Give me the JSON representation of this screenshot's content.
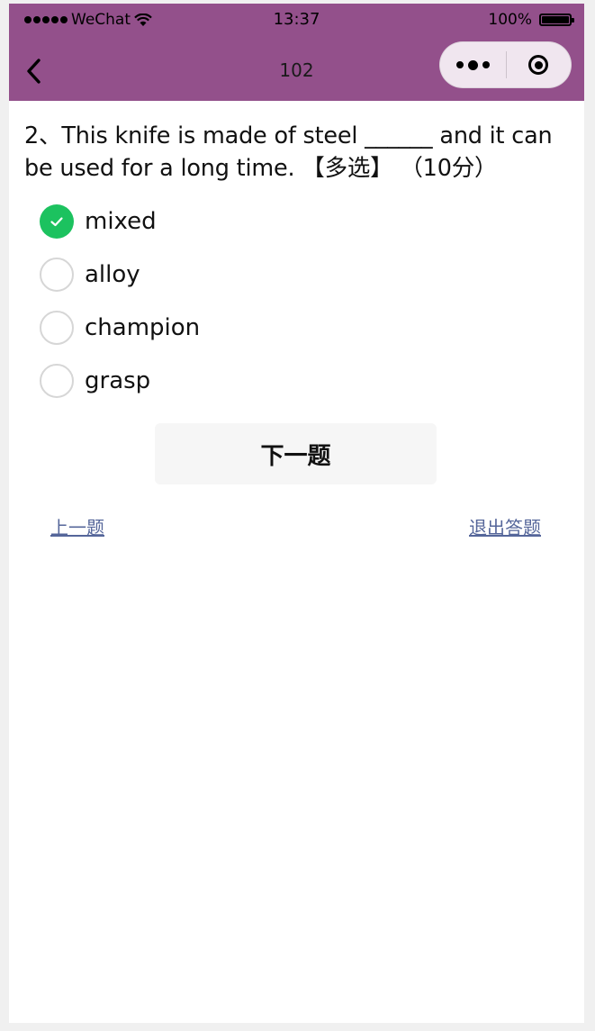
{
  "status_bar": {
    "carrier": "WeChat",
    "time": "13:37",
    "battery": "100%"
  },
  "nav": {
    "title": "102",
    "back_icon": "chevron-left-icon",
    "more_icon": "more-dots-icon",
    "close_icon": "target-circle-icon"
  },
  "question": {
    "text": "2、This knife is made of steel ______ and it can be used for a long time. 【多选】 （10分）"
  },
  "options": [
    {
      "label": "mixed",
      "checked": true
    },
    {
      "label": "alloy",
      "checked": false
    },
    {
      "label": "champion",
      "checked": false
    },
    {
      "label": "grasp",
      "checked": false
    }
  ],
  "buttons": {
    "next": "下一题",
    "prev": "上一题",
    "exit": "退出答题"
  },
  "colors": {
    "header": "#93508b",
    "checked": "#1cc25f",
    "link": "#55669a"
  }
}
